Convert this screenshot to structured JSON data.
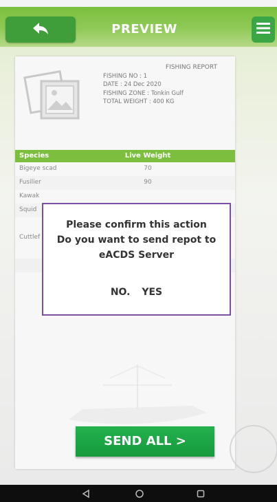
{
  "header": {
    "title": "PREVIEW",
    "back_icon": "back-arrow-icon",
    "menu_icon": "hamburger-menu-icon"
  },
  "report": {
    "heading": "FISHING REPORT",
    "fishing_no": "FISHING NO : 1",
    "date": "DATE : 24 Dec 2020",
    "zone": "FISHING ZONE : Tonkin Gulf",
    "total_weight": "TOTAL WEIGHT : 400 KG"
  },
  "table": {
    "headers": [
      "Species",
      "Live Weight"
    ],
    "rows": [
      {
        "species": "Bigeye scad",
        "weight": "70"
      },
      {
        "species": "Fusilier",
        "weight": "90"
      },
      {
        "species": "Kawak",
        "weight": ""
      },
      {
        "species": "Squid",
        "weight": ""
      },
      {
        "species": "Cuttlef",
        "weight": ""
      }
    ]
  },
  "dialog": {
    "line1": "Please confirm this action",
    "line2": "Do you want to send repot to",
    "line3": "eACDS Server",
    "no_label": "NO.",
    "yes_label": "YES"
  },
  "send_button": "SEND ALL >",
  "nav": {
    "back_icon": "nav-back-icon",
    "home_icon": "nav-home-icon",
    "recents_icon": "nav-recents-icon"
  },
  "colors": {
    "accent_green": "#7cbf3e",
    "button_green": "#1ea84a",
    "dialog_border": "#7a4ea1"
  }
}
